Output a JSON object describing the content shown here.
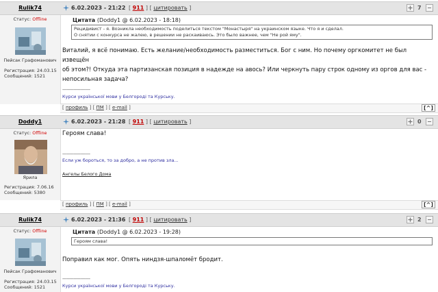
{
  "posts": [
    {
      "author": "Rulik74",
      "date": "6.02.2023 - 21:22",
      "post_num": "911",
      "quote_action": "цитировать",
      "status_label": "Статус:",
      "status_value": "Offline",
      "avatar_caption": "Пейсак Графоманович",
      "reg_label": "Регистрация: 24.03.15",
      "msg_label": "Сообщений: 1521",
      "rating": "7",
      "quote_header_bold": "Цитата",
      "quote_header_meta": "(Doddy1 @ 6.02.2023 - 18:18)",
      "quote_lines": [
        "Рецидивист - я. Возникла необходимость поделиться текстом \"Монастыря\" на украинском языке. Что я и сделал.",
        "О снятии с конкурса не жалею, в решении не раскаиваюсь. Это было важнее, чем \"Не рой яму\"."
      ],
      "body_lines": [
        "Виталий, я всё понимаю. Есть желание/необходимость разместиться. Бог с ним. Но почему оргкомитет не был извещён",
        "об этом?! Откуда эта партизанская позиция в надежде на авось? Или черкнуть пару строк одному из оргов для вас -",
        "непосильная задача?"
      ],
      "sig_divider": "--------------------",
      "signature": "Курси української мови у Белгороді та Курську."
    },
    {
      "author": "Doddy1",
      "date": "6.02.2023 - 21:28",
      "post_num": "911",
      "quote_action": "цитировать",
      "status_label": "Статус:",
      "status_value": "Offline",
      "avatar_caption": "Ярила",
      "reg_label": "Регистрация: 7.06.16",
      "msg_label": "Сообщений: 5380",
      "rating": "0",
      "body_lines": [
        "Героям слава!"
      ],
      "sig_divider": "--------------------",
      "signature": "Если уж бороться, то за добро, а не против зла...",
      "signature2": "Ангелы Белого Дома"
    },
    {
      "author": "Rulik74",
      "date": "6.02.2023 - 21:36",
      "post_num": "911",
      "quote_action": "цитировать",
      "status_label": "Статус:",
      "status_value": "Offline",
      "avatar_caption": "Пейсак Графоманович",
      "reg_label": "Регистрация: 24.03.15",
      "msg_label": "Сообщений: 1521",
      "rating": "2",
      "quote_header_bold": "Цитата",
      "quote_header_meta": "(Doddy1 @ 6.02.2023 - 19:28)",
      "quote_lines": [
        "Героям слава!"
      ],
      "body_lines": [
        "Поправил как мог. Опять ниндзя-шпаломёт бродит."
      ],
      "sig_divider": "--------------------",
      "signature": "Курси української мови у Белгороді та Курську."
    }
  ],
  "footer": {
    "profile": "профиль",
    "pm": "ПМ",
    "email": "e-mail",
    "top": "[^]"
  },
  "colors": {
    "offline": "#d00000",
    "post_num": "#c00000",
    "signature": "#2f2fa0"
  }
}
